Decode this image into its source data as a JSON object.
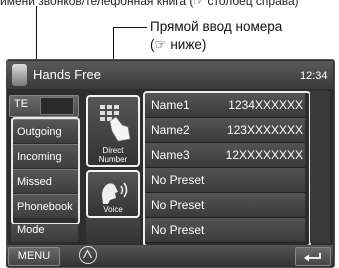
{
  "callouts": {
    "top_text": "имени звонков/телефонная книга (☞ столбец справа)",
    "direct_line1": "Прямой ввод номера",
    "direct_line2": "(☞ ниже)"
  },
  "header": {
    "title": "Hands Free",
    "time": "12:34"
  },
  "tel_tab": {
    "label": "TE"
  },
  "left_tabs": [
    "Outgoing",
    "Incoming",
    "Missed",
    "Phonebook"
  ],
  "mode_label": "Mode",
  "mid_buttons": {
    "direct_line1": "Direct",
    "direct_line2": "Number",
    "voice": "Voice"
  },
  "presets": [
    {
      "name": "Name1",
      "number": "1234XXXXXX"
    },
    {
      "name": "Name2",
      "number": "123XXXXXXX"
    },
    {
      "name": "Name3",
      "number": "12XXXXXXXX"
    },
    {
      "name": "No Preset",
      "number": ""
    },
    {
      "name": "No Preset",
      "number": ""
    },
    {
      "name": "No Preset",
      "number": ""
    }
  ],
  "footer": {
    "menu_label": "MENU"
  }
}
